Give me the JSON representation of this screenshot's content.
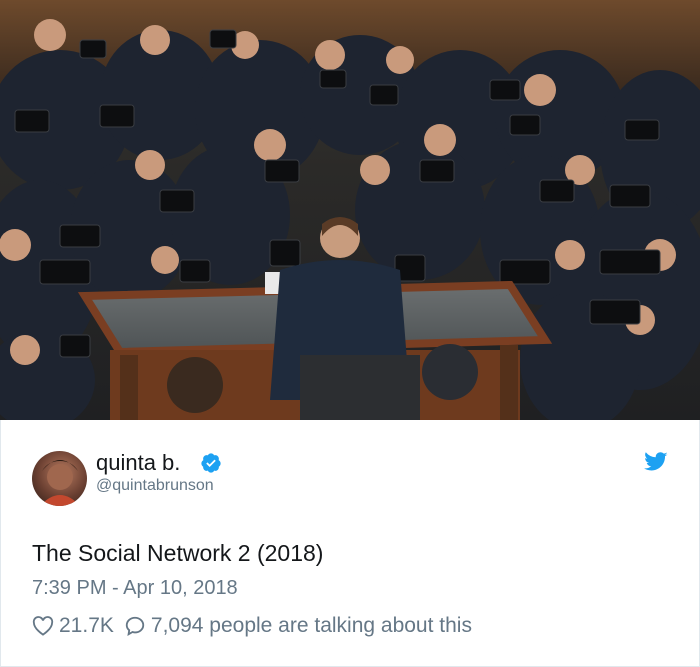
{
  "photo": {
    "alt_subject": "crowd-of-photographers"
  },
  "tweet": {
    "display_name": "quinta b.",
    "handle": "@quintabrunson",
    "text": "The Social Network 2 (2018)",
    "timestamp": "7:39 PM - Apr 10, 2018",
    "likes": "21.7K",
    "talking": "7,094 people are talking about this"
  },
  "colors": {
    "twitter_blue": "#1da1f2",
    "text_primary": "#14171a",
    "text_secondary": "#657786"
  },
  "icons": [
    "verified-badge-icon",
    "twitter-bird-icon",
    "heart-icon",
    "reply-bubble-icon"
  ]
}
